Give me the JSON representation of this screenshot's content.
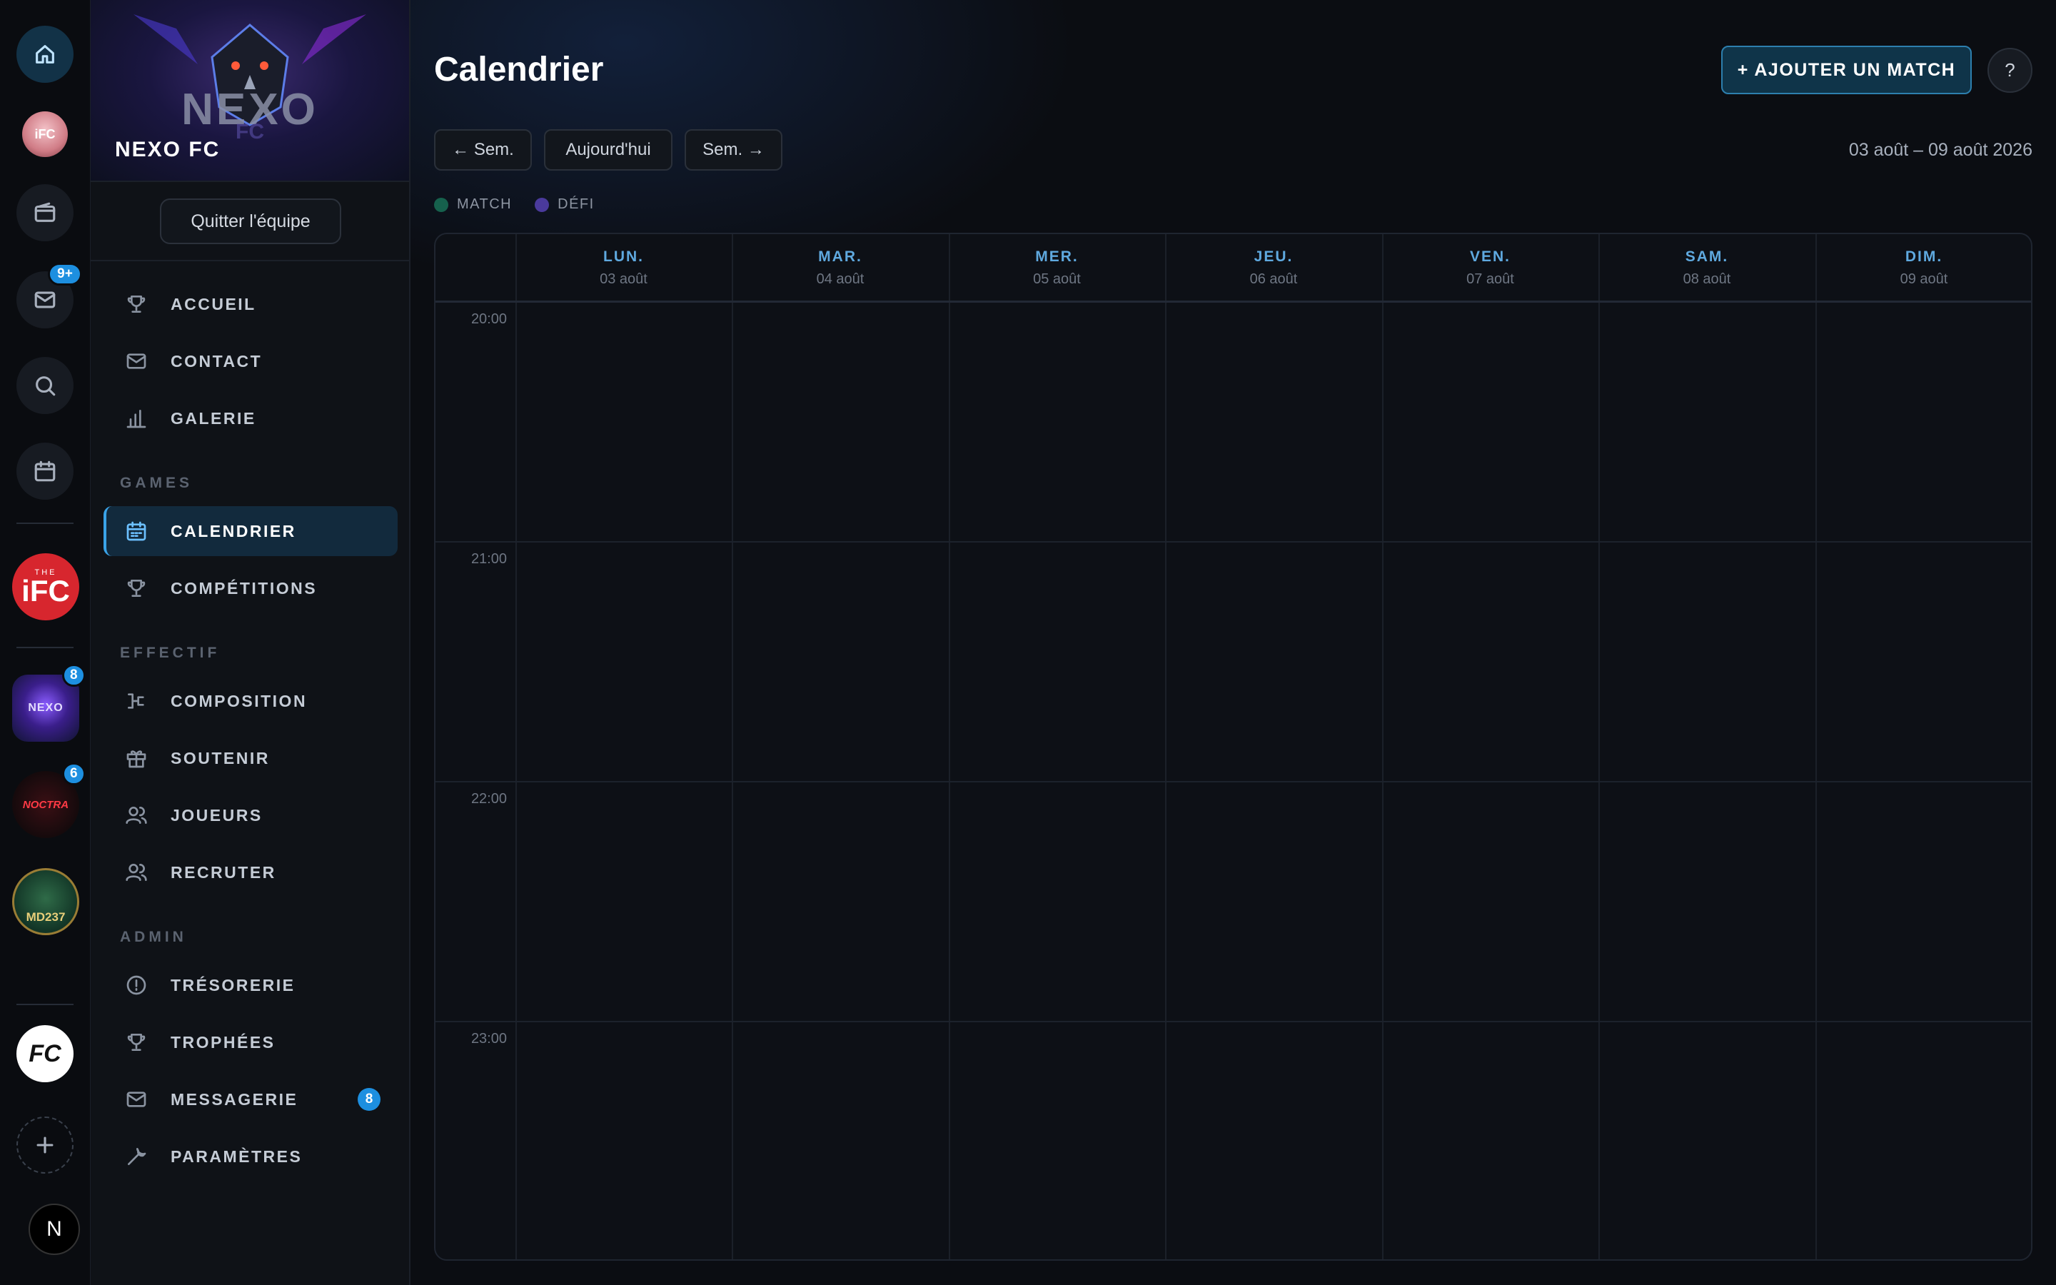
{
  "rail": {
    "home_icon": "home-icon",
    "wallet_icon": "wallet-icon",
    "mail_badge": "9+",
    "search_icon": "search-icon",
    "calendar_icon": "calendar-icon",
    "ifc_label": "iFC",
    "ifc_top": "THE",
    "nexo_badge": "8",
    "noctra_badge": "6",
    "noctra_label": "NOCTRA",
    "md_label": "MD237",
    "fc_label": "FC",
    "user_initial": "N"
  },
  "team": {
    "banner_text": "NEXO",
    "banner_sub": "FC",
    "name": "NEXO FC",
    "quit_label": "Quitter l'équipe"
  },
  "nav": {
    "items_top": [
      {
        "label": "ACCUEIL",
        "icon": "trophy-icon"
      },
      {
        "label": "CONTACT",
        "icon": "mail-icon"
      },
      {
        "label": "GALERIE",
        "icon": "bar-chart-icon"
      }
    ],
    "section_games": "GAMES",
    "items_games": [
      {
        "label": "CALENDRIER",
        "icon": "calendar-icon",
        "active": true
      },
      {
        "label": "COMPÉTITIONS",
        "icon": "trophy-icon"
      }
    ],
    "section_effectif": "EFFECTIF",
    "items_effectif": [
      {
        "label": "COMPOSITION",
        "icon": "bracket-icon"
      },
      {
        "label": "SOUTENIR",
        "icon": "gift-icon"
      },
      {
        "label": "JOUEURS",
        "icon": "users-icon"
      },
      {
        "label": "RECRUTER",
        "icon": "users-icon"
      }
    ],
    "section_admin": "ADMIN",
    "items_admin": [
      {
        "label": "TRÉSORERIE",
        "icon": "alert-circle-icon"
      },
      {
        "label": "TROPHÉES",
        "icon": "trophy-icon"
      },
      {
        "label": "MESSAGERIE",
        "icon": "mail-icon",
        "badge": "8"
      },
      {
        "label": "PARAMÈTRES",
        "icon": "wrench-icon"
      }
    ]
  },
  "main": {
    "title": "Calendrier",
    "add_match_label": "+ AJOUTER UN MATCH",
    "help_label": "?",
    "prev_week_label": "← Sem.",
    "today_label": "Aujourd'hui",
    "next_week_label": "Sem. →",
    "date_range": "03 août – 09 août 2026",
    "legend": [
      {
        "label": "MATCH",
        "color": "#16614d"
      },
      {
        "label": "DÉFI",
        "color": "#4a3a9c"
      }
    ],
    "days": [
      {
        "name": "LUN.",
        "date": "03 août"
      },
      {
        "name": "MAR.",
        "date": "04 août"
      },
      {
        "name": "MER.",
        "date": "05 août"
      },
      {
        "name": "JEU.",
        "date": "06 août"
      },
      {
        "name": "VEN.",
        "date": "07 août"
      },
      {
        "name": "SAM.",
        "date": "08 août"
      },
      {
        "name": "DIM.",
        "date": "09 août"
      }
    ],
    "hours": [
      "20:00",
      "21:00",
      "22:00",
      "23:00"
    ]
  },
  "colors": {
    "accent": "#3aa3e8",
    "badge": "#1d8fe0",
    "background": "#0b0d12"
  }
}
